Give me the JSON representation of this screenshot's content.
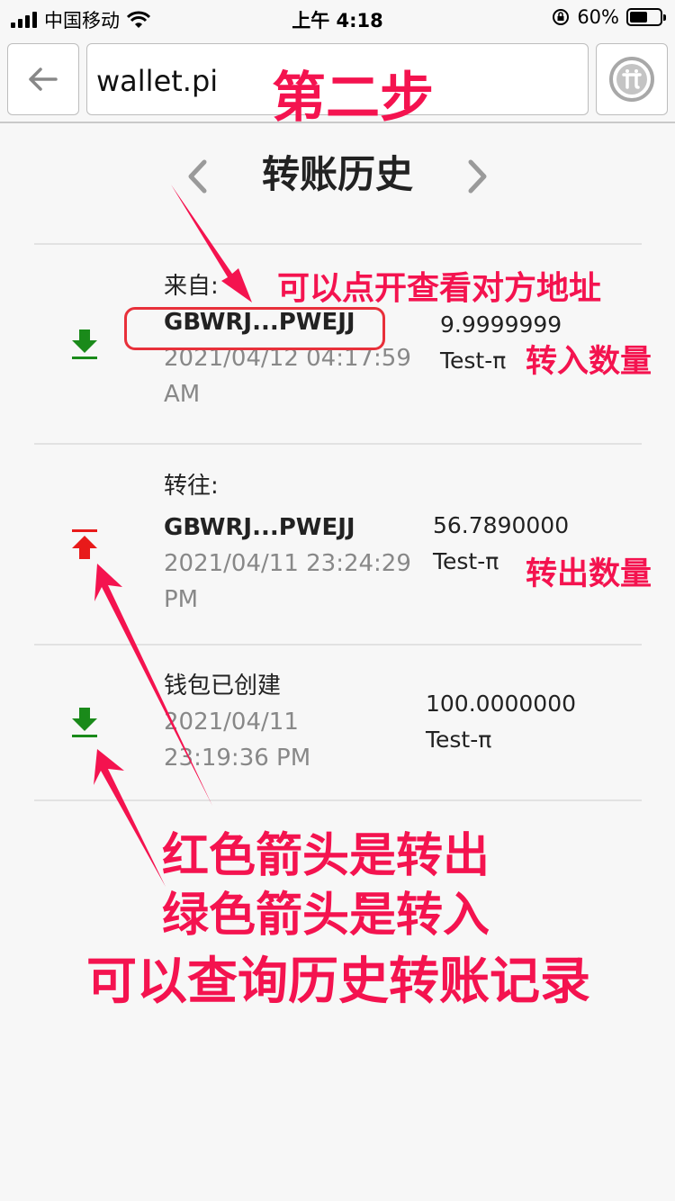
{
  "status_bar": {
    "carrier": "中国移动",
    "time": "上午 4:18",
    "battery": "60%",
    "battery_level": 0.6
  },
  "browser": {
    "url": "wallet.pi"
  },
  "page": {
    "title": "转账历史"
  },
  "transactions": [
    {
      "direction": "in",
      "direction_label": "来自:",
      "address": "GBWRJ...PWEJJ",
      "timestamp_line1": "2021/04/12 04:17:59",
      "timestamp_line2": "AM",
      "amount": "9.9999999",
      "currency": "Test-π",
      "icon_color": "#1a8a1a"
    },
    {
      "direction": "out",
      "direction_label": "转往:",
      "address": "GBWRJ...PWEJJ",
      "timestamp_line1": "2021/04/11 23:24:29",
      "timestamp_line2": "PM",
      "amount": "56.7890000",
      "currency": "Test-π",
      "icon_color": "#e81a1a"
    },
    {
      "direction": "in",
      "direction_label": "钱包已创建",
      "timestamp_line1": "2021/04/11",
      "timestamp_line2": "23:19:36 PM",
      "amount": "100.0000000",
      "currency": "Test-π",
      "icon_color": "#1a8a1a"
    }
  ],
  "annotations": {
    "step": "第二步",
    "view_address": "可以点开查看对方地址",
    "in_amount": "转入数量",
    "out_amount": "转出数量",
    "line1": "红色箭头是转出",
    "line2": "绿色箭头是转入",
    "line3": "可以查询历史转账记录",
    "color": "#f4134f"
  }
}
